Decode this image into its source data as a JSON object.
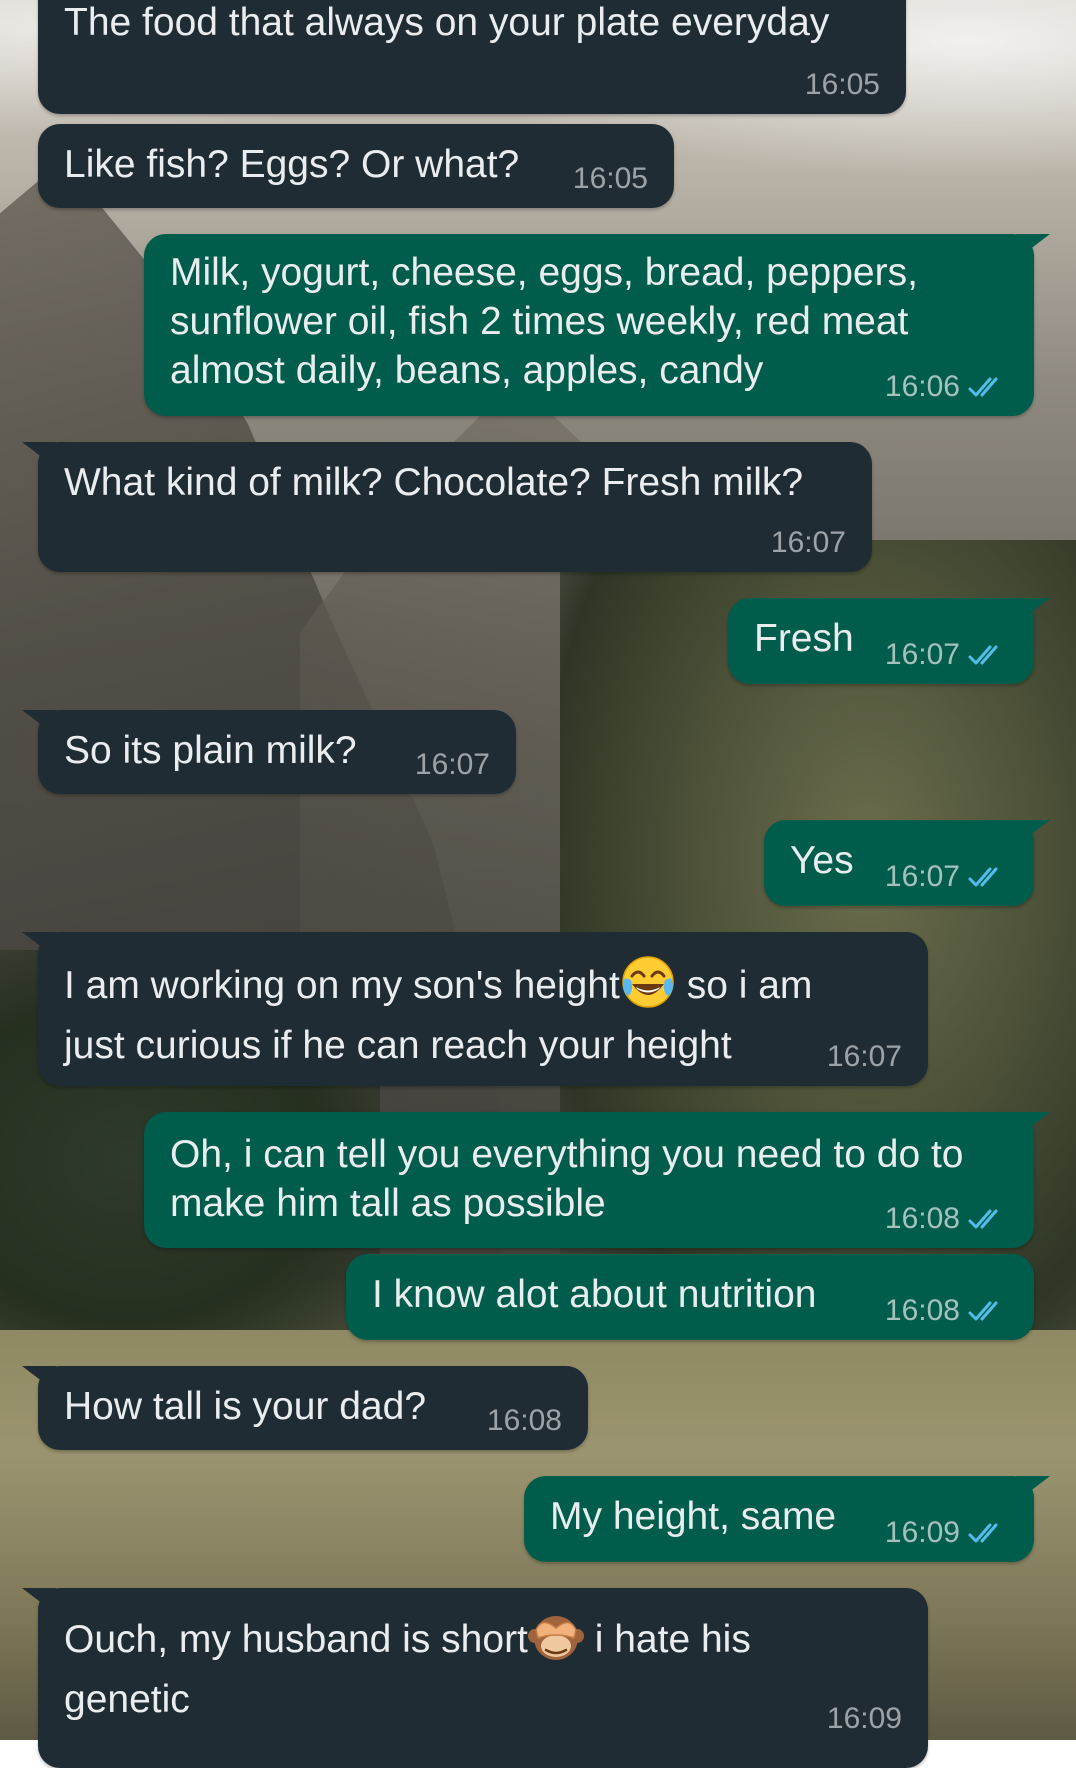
{
  "colors": {
    "incoming_bubble": "#202c33",
    "outgoing_bubble": "#005c4b",
    "text": "#e9edef",
    "read_ticks": "#53bdeb"
  },
  "messages": [
    {
      "direction": "in",
      "text": "The food that always on your plate everyday",
      "time": "16:05"
    },
    {
      "direction": "in",
      "text": "Like fish? Eggs? Or what?",
      "time": "16:05"
    },
    {
      "direction": "out",
      "text": "Milk, yogurt, cheese, eggs, bread, peppers, sunflower oil, fish 2 times weekly, red meat almost daily, beans, apples, candy",
      "time": "16:06",
      "status": "read"
    },
    {
      "direction": "in",
      "text": "What kind of milk? Chocolate? Fresh milk?",
      "time": "16:07"
    },
    {
      "direction": "out",
      "text": "Fresh",
      "time": "16:07",
      "status": "read"
    },
    {
      "direction": "in",
      "text": "So its plain milk?",
      "time": "16:07"
    },
    {
      "direction": "out",
      "text": "Yes",
      "time": "16:07",
      "status": "read"
    },
    {
      "direction": "in",
      "text_before_emoji": "I am working on my son's height",
      "emoji": "face-with-tears-of-joy",
      "text_after_emoji": " so i am just curious if he can reach your height",
      "time": "16:07"
    },
    {
      "direction": "out",
      "text": "Oh, i can tell you everything you need to do to make him tall as possible",
      "time": "16:08",
      "status": "read"
    },
    {
      "direction": "out",
      "text": "I know alot about nutrition",
      "time": "16:08",
      "status": "read"
    },
    {
      "direction": "in",
      "text": "How tall is your dad?",
      "time": "16:08"
    },
    {
      "direction": "out",
      "text": "My height, same",
      "time": "16:09",
      "status": "read"
    },
    {
      "direction": "in",
      "text_before_emoji": "Ouch, my husband is short",
      "emoji": "see-no-evil-monkey",
      "text_after_emoji": " i hate his genetic",
      "time": "16:09"
    }
  ]
}
